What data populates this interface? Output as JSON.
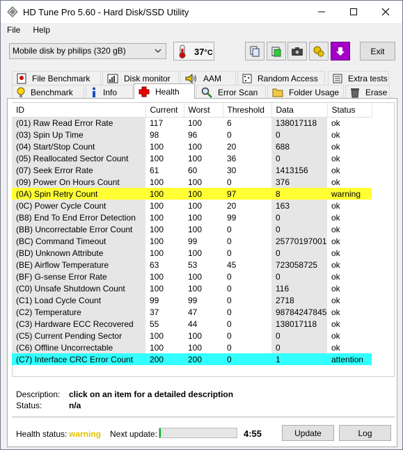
{
  "window": {
    "title": "HD Tune Pro 5.60 - Hard Disk/SSD Utility"
  },
  "menu": [
    "File",
    "Help"
  ],
  "toolbar": {
    "drive": "Mobile  disk by philips (320 gB)",
    "temperature": "37",
    "temperature_unit": "°C",
    "exit_label": "Exit"
  },
  "tabs_row1": [
    "File Benchmark",
    "Disk monitor",
    "AAM",
    "Random Access",
    "Extra tests"
  ],
  "tabs_row2": [
    "Benchmark",
    "Info",
    "Health",
    "Error Scan",
    "Folder Usage",
    "Erase"
  ],
  "active_tab": "Health",
  "table": {
    "headers": [
      "ID",
      "Current",
      "Worst",
      "Threshold",
      "Data",
      "Status"
    ],
    "rows": [
      {
        "id": "(01) Raw Read Error Rate",
        "current": "117",
        "worst": "100",
        "threshold": "6",
        "data": "138017118",
        "status": "ok",
        "hl": ""
      },
      {
        "id": "(03) Spin Up Time",
        "current": "98",
        "worst": "96",
        "threshold": "0",
        "data": "0",
        "status": "ok",
        "hl": ""
      },
      {
        "id": "(04) Start/Stop Count",
        "current": "100",
        "worst": "100",
        "threshold": "20",
        "data": "688",
        "status": "ok",
        "hl": ""
      },
      {
        "id": "(05) Reallocated Sector Count",
        "current": "100",
        "worst": "100",
        "threshold": "36",
        "data": "0",
        "status": "ok",
        "hl": ""
      },
      {
        "id": "(07) Seek Error Rate",
        "current": "61",
        "worst": "60",
        "threshold": "30",
        "data": "1413156",
        "status": "ok",
        "hl": ""
      },
      {
        "id": "(09) Power On Hours Count",
        "current": "100",
        "worst": "100",
        "threshold": "0",
        "data": "376",
        "status": "ok",
        "hl": ""
      },
      {
        "id": "(0A) Spin Retry Count",
        "current": "100",
        "worst": "100",
        "threshold": "97",
        "data": "8",
        "status": "warning",
        "hl": "#ffff33"
      },
      {
        "id": "(0C) Power Cycle Count",
        "current": "100",
        "worst": "100",
        "threshold": "20",
        "data": "163",
        "status": "ok",
        "hl": ""
      },
      {
        "id": "(B8) End To End Error Detection",
        "current": "100",
        "worst": "100",
        "threshold": "99",
        "data": "0",
        "status": "ok",
        "hl": ""
      },
      {
        "id": "(BB) Uncorrectable Error Count",
        "current": "100",
        "worst": "100",
        "threshold": "0",
        "data": "0",
        "status": "ok",
        "hl": ""
      },
      {
        "id": "(BC) Command Timeout",
        "current": "100",
        "worst": "99",
        "threshold": "0",
        "data": "25770197001",
        "status": "ok",
        "hl": ""
      },
      {
        "id": "(BD) Unknown Attribute",
        "current": "100",
        "worst": "100",
        "threshold": "0",
        "data": "0",
        "status": "ok",
        "hl": ""
      },
      {
        "id": "(BE) Airflow Temperature",
        "current": "63",
        "worst": "53",
        "threshold": "45",
        "data": "723058725",
        "status": "ok",
        "hl": ""
      },
      {
        "id": "(BF) G-sense Error Rate",
        "current": "100",
        "worst": "100",
        "threshold": "0",
        "data": "0",
        "status": "ok",
        "hl": ""
      },
      {
        "id": "(C0) Unsafe Shutdown Count",
        "current": "100",
        "worst": "100",
        "threshold": "0",
        "data": "116",
        "status": "ok",
        "hl": ""
      },
      {
        "id": "(C1) Load Cycle Count",
        "current": "99",
        "worst": "99",
        "threshold": "0",
        "data": "2718",
        "status": "ok",
        "hl": ""
      },
      {
        "id": "(C2) Temperature",
        "current": "37",
        "worst": "47",
        "threshold": "0",
        "data": "98784247845",
        "status": "ok",
        "hl": ""
      },
      {
        "id": "(C3) Hardware ECC Recovered",
        "current": "55",
        "worst": "44",
        "threshold": "0",
        "data": "138017118",
        "status": "ok",
        "hl": ""
      },
      {
        "id": "(C5) Current Pending Sector",
        "current": "100",
        "worst": "100",
        "threshold": "0",
        "data": "0",
        "status": "ok",
        "hl": ""
      },
      {
        "id": "(C6) Offline Uncorrectable",
        "current": "100",
        "worst": "100",
        "threshold": "0",
        "data": "0",
        "status": "ok",
        "hl": ""
      },
      {
        "id": "(C7) Interface CRC Error Count",
        "current": "200",
        "worst": "200",
        "threshold": "0",
        "data": "1",
        "status": "attention",
        "hl": "#33ffff"
      }
    ]
  },
  "description": {
    "label": "Description:",
    "value": "click on an item for a detailed description",
    "status_label": "Status:",
    "status_value": "n/a"
  },
  "footer": {
    "health_label": "Health status:",
    "health_value": "warning",
    "health_color": "#e5c100",
    "next_update_label": "Next update:",
    "progress": 0.02,
    "countdown": "4:55",
    "update_label": "Update",
    "log_label": "Log"
  }
}
